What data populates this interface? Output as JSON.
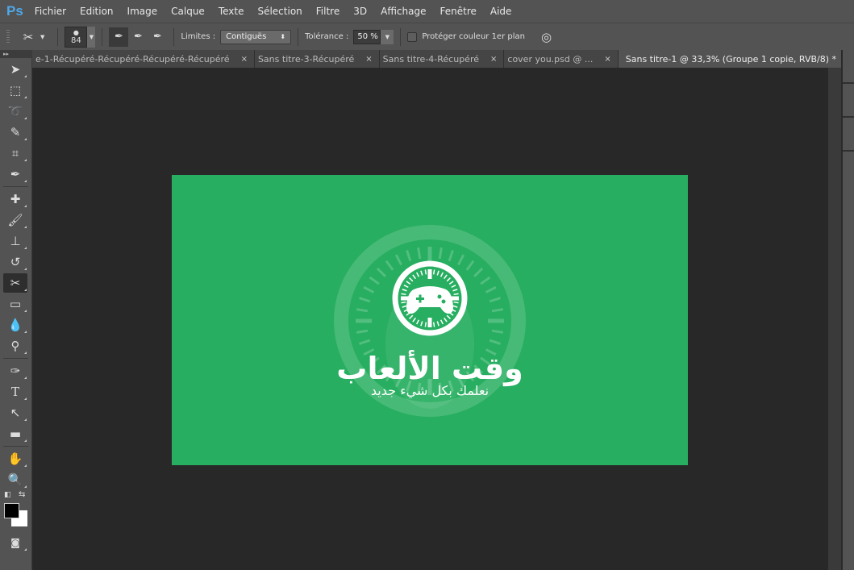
{
  "app": {
    "logo": "Ps"
  },
  "menu": [
    "Fichier",
    "Edition",
    "Image",
    "Calque",
    "Texte",
    "Sélection",
    "Filtre",
    "3D",
    "Affichage",
    "Fenêtre",
    "Aide"
  ],
  "options": {
    "brush_size": "84",
    "limits_label": "Limites :",
    "limits_value": "Contiguës",
    "tolerance_label": "Tolérance :",
    "tolerance_value": "50 %",
    "protect_label": "Protéger couleur 1er plan"
  },
  "tabs": [
    {
      "label": "e-1-Récupéré-Récupéré-Récupéré-Récupéré",
      "close": "×"
    },
    {
      "label": "Sans titre-3-Récupéré",
      "close": "×"
    },
    {
      "label": "Sans titre-4-Récupéré",
      "close": "×"
    },
    {
      "label": "cover you.psd @ ...",
      "close": "×"
    },
    {
      "label": "Sans titre-1 @ 33,3% (Groupe 1 copie, RVB/8) *",
      "close": "×"
    }
  ],
  "tabs_more": ">>",
  "toolbox_head": "▸▸",
  "artwork": {
    "title": "وقت الألعاب",
    "subtitle": "نعلمك بكل شيء جديد",
    "green": "#27ae60"
  }
}
